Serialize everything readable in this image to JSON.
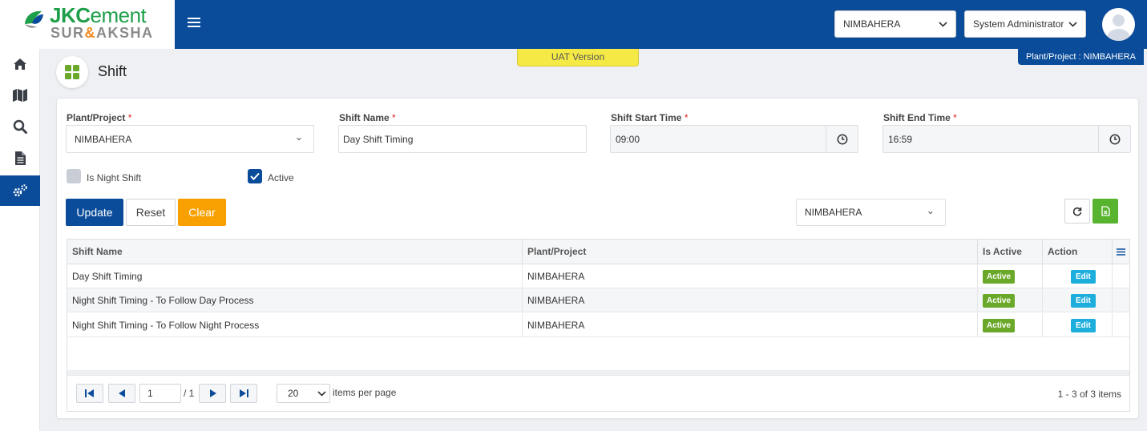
{
  "brand": {
    "line1_bold": "JKC",
    "line1_rest": "ement",
    "line2_a": "SUR",
    "line2_amp": "&",
    "line2_b": "AKSHA"
  },
  "header": {
    "plant_select": "NIMBAHERA",
    "role_select": "System Administrator"
  },
  "sidebar": {
    "items": [
      {
        "icon": "home-icon"
      },
      {
        "icon": "map-icon"
      },
      {
        "icon": "search-icon"
      },
      {
        "icon": "document-icon"
      },
      {
        "icon": "settings-icon",
        "active": true
      }
    ]
  },
  "page": {
    "title": "Shift",
    "uat_label": "UAT Version",
    "plant_badge": "Plant/Project : NIMBAHERA"
  },
  "form": {
    "plant_label": "Plant/Project",
    "plant_value": "NIMBAHERA",
    "shift_name_label": "Shift Name",
    "shift_name_value": "Day Shift Timing",
    "start_label": "Shift Start Time",
    "start_value": "09:00",
    "end_label": "Shift End Time",
    "end_value": "16:59",
    "required_mark": "*",
    "night_shift_label": "Is Night Shift",
    "night_shift_checked": false,
    "active_label": "Active",
    "active_checked": true
  },
  "toolbar": {
    "update_label": "Update",
    "reset_label": "Reset",
    "clear_label": "Clear",
    "filter_value": "NIMBAHERA"
  },
  "grid": {
    "columns": [
      "Shift Name",
      "Plant/Project",
      "Is Active",
      "Action"
    ],
    "rows": [
      {
        "shift_name": "Day Shift Timing",
        "plant": "NIMBAHERA",
        "status": "Active",
        "action": "Edit"
      },
      {
        "shift_name": "Night Shift Timing - To Follow Day Process",
        "plant": "NIMBAHERA",
        "status": "Active",
        "action": "Edit"
      },
      {
        "shift_name": "Night Shift Timing - To Follow Night Process",
        "plant": "NIMBAHERA",
        "status": "Active",
        "action": "Edit"
      }
    ]
  },
  "pager": {
    "current_page": "1",
    "total_pages": "/ 1",
    "page_size": "20",
    "items_per_page_label": "items per page",
    "summary": "1 - 3 of 3 items"
  },
  "colors": {
    "primary": "#0a4c9a",
    "active_badge": "#6aa829",
    "edit_badge": "#1eaedb",
    "clear_button": "#f7a000",
    "uat_badge": "#f5ea45",
    "excel_button": "#58b32f"
  }
}
